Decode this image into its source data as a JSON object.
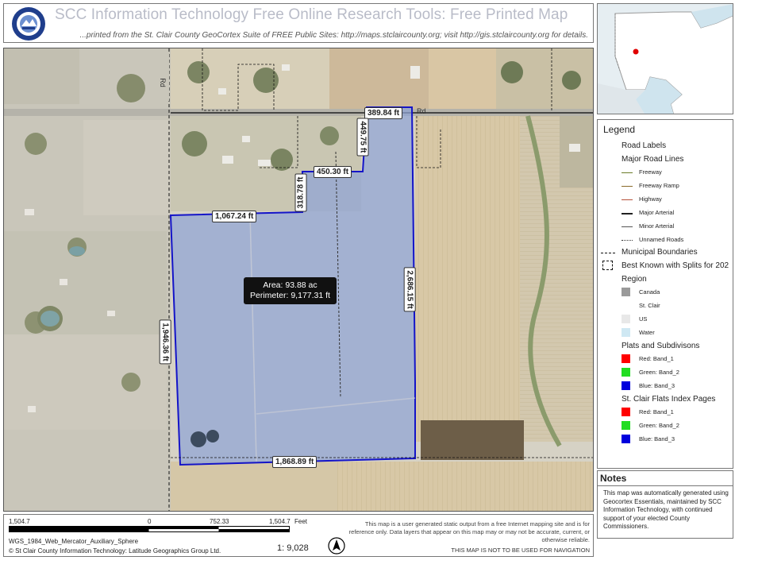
{
  "header": {
    "title": "SCC Information Technology Free Online Research Tools: Free Printed Map",
    "subtitle": "...printed from the St. Clair County GeoCortex Suite of FREE Public Sites: http://maps.stclaircounty.org; visit http://gis.stclaircounty.org for details."
  },
  "map": {
    "road_labels": [
      "Rd",
      "Rd"
    ],
    "measurements": [
      "389.84 ft",
      "449.75 ft",
      "450.30 ft",
      "318.78 ft",
      "1,067.24 ft",
      "2,686.15 ft",
      "1,946.36 ft",
      "1,868.89 ft"
    ],
    "area": "Area: 93.88 ac",
    "perimeter": "Perimeter: 9,177.31 ft"
  },
  "legend": {
    "title": "Legend",
    "road_labels": "Road Labels",
    "major_road_lines": "Major Road Lines",
    "road_types": [
      {
        "label": "Freeway",
        "color": "#6b7d2a"
      },
      {
        "label": "Freeway Ramp",
        "color": "#8a6a2a"
      },
      {
        "label": "Highway",
        "color": "#b5523a"
      },
      {
        "label": "Major Arterial",
        "color": "#222222"
      },
      {
        "label": "Minor Arterial",
        "color": "#555555"
      },
      {
        "label": "Unnamed Roads",
        "color": "#333333"
      }
    ],
    "municipal_boundaries": "Municipal Boundaries",
    "best_known": "Best Known with Splits for 202",
    "region": "Region",
    "region_items": [
      {
        "label": "Canada",
        "color": "#9a9a9a"
      },
      {
        "label": "St. Clair",
        "color": "#ffffff"
      },
      {
        "label": "US",
        "color": "#e8e8e8"
      },
      {
        "label": "Water",
        "color": "#cfe8f3"
      }
    ],
    "plats": "Plats and Subdivisons",
    "plat_items": [
      {
        "label": "Red:   Band_1",
        "color": "#ff0000"
      },
      {
        "label": "Green: Band_2",
        "color": "#22dd22"
      },
      {
        "label": "Blue:  Band_3",
        "color": "#0000dd"
      }
    ],
    "flats": "St. Clair Flats Index Pages",
    "flats_items": [
      {
        "label": "Red:   Band_1",
        "color": "#ff0000"
      },
      {
        "label": "Green: Band_2",
        "color": "#22dd22"
      },
      {
        "label": "Blue:  Band_3",
        "color": "#0000dd"
      }
    ]
  },
  "notes": {
    "title": "Notes",
    "text": "This map was automatically generated using Geocortex Essentials, maintained by SCC Information Technology, with continued support of your elected County Commissioners."
  },
  "scalebar": {
    "labels": [
      "1,504.7",
      "0",
      "752.33",
      "1,504.7"
    ],
    "unit": "Feet"
  },
  "footer": {
    "projection": "WGS_1984_Web_Mercator_Auxiliary_Sphere",
    "copyright": "© St Clair County Information Technology: Latitude Geographics Group Ltd.",
    "scale_ratio": "1: 9,028",
    "disclaimer": "This map is a user generated static output from a free Internet mapping site and is for reference only. Data layers that appear on this map may or may not be accurate, current, or otherwise reliable.",
    "no_nav": "THIS MAP IS NOT TO BE USED FOR NAVIGATION"
  },
  "colors": {
    "parcel_fill": "#8fa3d6",
    "parcel_outline": "#1414c8",
    "locator_dot": "#e00000"
  }
}
